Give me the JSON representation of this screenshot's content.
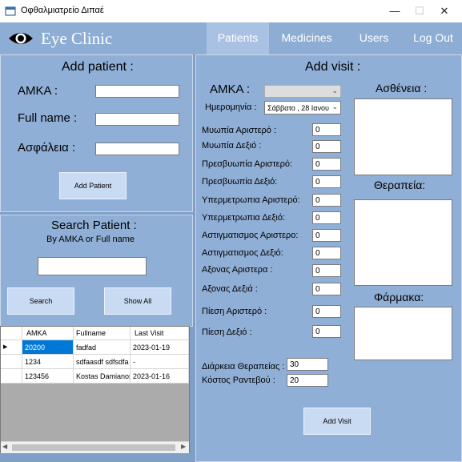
{
  "window": {
    "title": "Οφθαλμιατρείο Διπαέ",
    "minimize_glyph": "—",
    "maximize_glyph": "☐",
    "close_glyph": "✕"
  },
  "header": {
    "brand": "Eye Clinic",
    "nav": [
      {
        "label": "Patients",
        "active": true
      },
      {
        "label": "Medicines",
        "active": false
      },
      {
        "label": "Users",
        "active": false
      },
      {
        "label": "Log Out",
        "active": false
      }
    ]
  },
  "add_patient": {
    "title": "Add patient :",
    "amka_label": "AMKA :",
    "fullname_label": "Full name :",
    "insurance_label": "Ασφάλεια :",
    "amka_value": "",
    "fullname_value": "",
    "insurance_value": "",
    "button": "Add Patient"
  },
  "search": {
    "title": "Search Patient :",
    "subtitle": "By AMKA or Full name",
    "value": "",
    "search_button": "Search",
    "show_all_button": "Show All"
  },
  "grid": {
    "columns": [
      "AMKA",
      "Fullname",
      "Last Visit"
    ],
    "rows": [
      {
        "amka": "20200",
        "fullname": "fadfad",
        "last_visit": "2023-01-19",
        "selected": true
      },
      {
        "amka": "1234",
        "fullname": "sdfaasdf sdfsdfa",
        "last_visit": "-",
        "selected": false
      },
      {
        "amka": "123456",
        "fullname": "Kostas Damianos",
        "last_visit": "2023-01-16",
        "selected": false
      }
    ],
    "current_row_marker": "▶",
    "scroll_left": "◀",
    "scroll_right": "▶"
  },
  "add_visit": {
    "title": "Add visit :",
    "amka_label": "AMKA :",
    "date_label": "Ημερομηνία :",
    "date_value": "Σάββατο , 28  Ιανου",
    "fields": [
      {
        "label": "Μυωπία Αριστερό :",
        "value": "0"
      },
      {
        "label": "Μυωπία Δεξιό :",
        "value": "0"
      },
      {
        "label": "Πρεσβυωπία Αριστερό:",
        "value": "0"
      },
      {
        "label": "Πρεσβυωπία Δεξιό:",
        "value": "0"
      },
      {
        "label": "Υπερμετρωπια Αριστερό:",
        "value": "0"
      },
      {
        "label": "Υπερμετρωπια Δεξιό:",
        "value": "0"
      },
      {
        "label": "Αστιγματισμος Αριστερο:",
        "value": "0"
      },
      {
        "label": "Αστιγματισμος Δεξιό:",
        "value": "0"
      },
      {
        "label": "Αξονας Αριστερα :",
        "value": "0"
      },
      {
        "label": "Αξονας Δεξιά :",
        "value": "0"
      },
      {
        "label": "Πίεση Αριστερό :",
        "value": "0"
      },
      {
        "label": "Πίεση Δεξιό :",
        "value": "0"
      }
    ],
    "duration_label": "Διάρκεια Θεραπείας :",
    "duration_value": "30",
    "cost_label": "Κόστος Ραντεβού :",
    "cost_value": "20",
    "illness_label": "Ασθένεια :",
    "therapy_label": "Θεραπεία:",
    "medicine_label": "Φάρμακα:",
    "button": "Add Visit"
  }
}
